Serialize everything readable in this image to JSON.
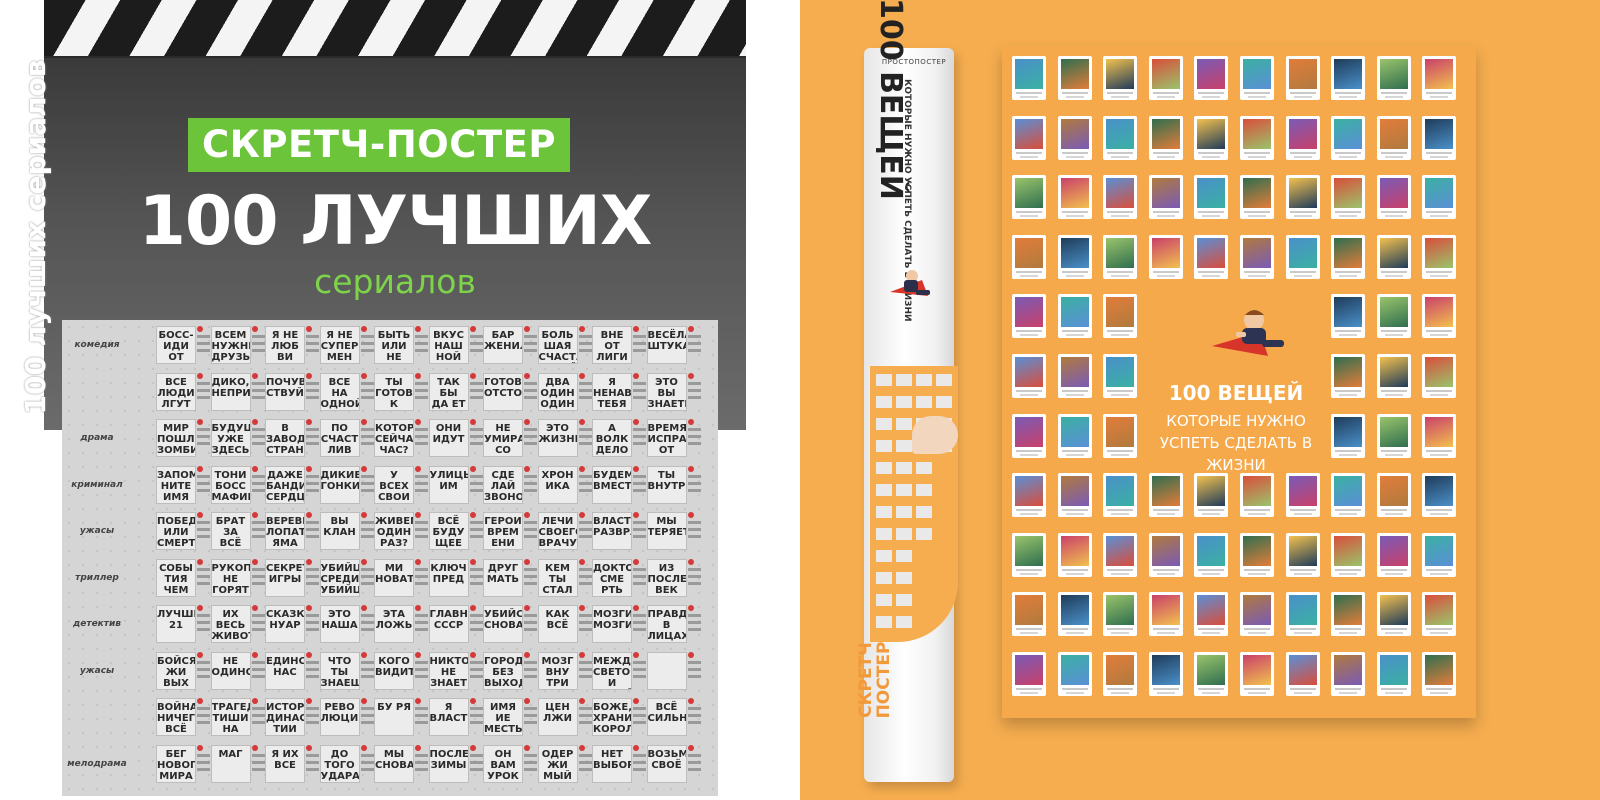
{
  "left_product": {
    "badge": "СКРЕТЧ-ПОСТЕР",
    "title": "100 ЛУЧШИХ",
    "subtitle": "сериалов",
    "poster_vertical_text": "100 лучших сериалов",
    "genres": [
      "комедия",
      "",
      "драма",
      "криминал",
      "ужасы",
      "триллер",
      "детектив",
      "ужасы",
      "",
      "мелодрама"
    ],
    "tiles_row1": [
      "БОСС-ИДИ ОТ",
      "ВСЕМ НУЖНЫ ДРУЗЬЯ",
      "Я НЕ ЛЮБ ВИ",
      "Я НЕ СУПЕР МЕН",
      "БЫТЬ ИЛИ НЕ",
      "ВКУС НАШ НОЙ",
      "БАР ЖЕНИЛ",
      "БОЛЬ ШАЯ СЧАСТЛИВАЯ СЕМЕЙКА",
      "ВНЕ ОТ ЛИГИ",
      "ВЕСЁЛАЯ ШТУКА"
    ],
    "tiles_row2": [
      "ВСЕ ЛЮДИ ЛГУТ",
      "ДИКО, НЕПРИЛИЧНО",
      "ПОЧУВ СТВУЙ",
      "ВСЕ НА ОДНОЙ УЛИЦЕ",
      "ТЫ ГОТОВ К",
      "ТАК БЫ ДА ЕТ",
      "ГОТОВЬ ОТСТОЙ",
      "ДВА ОДИН ОДИН",
      "Я НЕНАВИЖУ ТЕБЯ",
      "ЭТО ВЫ ЗНАЕТЕ"
    ],
    "tiles_row3": [
      "МИР ПОШЛИ ЗОМБИ",
      "БУДУЩЕЕ УЖЕ ЗДЕСЬ",
      "В ЗАВОДЕ СТРАН НОГО",
      "ПО СЧАСТ ЛИВ",
      "КОТОРЫЙ СЕЙЧАС ЧАС?",
      "ОНИ ИДУТ",
      "НЕ УМИРАЙ СО СМЕХУ",
      "ЭТО ЖИЗНЬ",
      "А ВОЛК ДЕЛО ГОВОРИТ",
      "ВРЕМЯ ИСПРАВИТЬ ОТ ЗЛА"
    ],
    "tiles_row4": [
      "ЗАПОМ НИТЕ ИМЯ",
      "ТОНИ БОСС МАФИИ",
      "ДАЖЕ БАНДИТА СЕРДЦЕ",
      "ДИКИЕ ГОНКИ",
      "У ВСЕХ СВОИ СЕКРЕТЫ",
      "УЛИЦЫ ИМ",
      "СДЕ ЛАЙ ЗВОНОК",
      "ХРОН ИКА",
      "БУДЕМ ВМЕСТЕ",
      "ТЫ ВНУТРИ"
    ],
    "tiles_row5": [
      "ПОБЕДА ИЛИ СМЕРТЬ",
      "БРАТ ЗА ВСЁ",
      "ВЕРЕВКА, ЛОПАТА, ЯМА",
      "ВЫ КЛАН",
      "ЖИВЕМ ОДИН РАЗ?",
      "ВСЁ БУДУ ЩЕЕ",
      "ГЕРОИ ВРЕМ ЕНИ",
      "ЛЕЧИ СВОЕГО ВРАЧУ",
      "ВЛАСТЬ РАЗВРАТ",
      "МЫ ТЕРЯЕТЕ"
    ],
    "tiles_row6": [
      "СОБЫ ТИЯ ЧЕМ КАЖУТСЯ",
      "РУКОПИСИ НЕ ГОРЯТ",
      "СЕКРЕТНЫЕ ИГРЫ",
      "УБИЙЦА СРЕДИ УБИЙЦ",
      "МИ НОВАТЬ",
      "КЛЮЧ ПРЕД",
      "ДРУГ МАТЬ",
      "КЕМ ТЫ СТАЛ",
      "ДОКТОР СМЕ РТЬ",
      "ИЗ ПОСЛЕДНИХ ВЕК"
    ],
    "tiles_row7": [
      "ЛУЧШИЙ 21",
      "ИХ ВЕСЬ ЖИВОТНОЕ",
      "СКАЗКИ НУАР",
      "ЭТО НАША",
      "ЭТА ЛОЖЬ",
      "ГЛАВНАЯ СССР",
      "УБИЙСТВО СНОВА",
      "КАК ВСЁ",
      "МОЗГИ МОЗГИ",
      "ПРАВДА В ЛИЦАХ"
    ],
    "tiles_row8": [
      "БОЙСЯ ЖИ ВЫХ",
      "НЕ ОДИНОЧЕСТВО",
      "ЕДИНСТВО НАС",
      "ЧТО ТЫ ЗНАЕШЬ?",
      "КОГО ВИДИТЕ?",
      "НИКТО НЕ ЗНАЕТ",
      "ГОРОД БЕЗ ВЫХОДА",
      "МОЗГ ВНУ ТРИ",
      "МЕЖДУ СВЕТОМ И ТЬМОЙ"
    ],
    "tiles_row9": [
      "ВОЙНА НИЧЕГО ВСЁ",
      "ТРАГЕДИЯ ТИШИ НА",
      "ИСТОРИЯ ДИНАС ТИИ",
      "РЕВО ЛЮЦИИ",
      "БУ РЯ",
      "Я ВЛАСТЬ",
      "ИМЯ ИЕ МЕСТЬ",
      "ЦЕН ЛЖИ",
      "БОЖЕ, ХРАНИ КОРОЛЕВУ",
      "ВСЁ СИЛЬНЕЕ"
    ],
    "tiles_row10": [
      "БЕГ НОВОГО МИРА",
      "МАГ",
      "Я ИХ ВСЕ",
      "ДО ТОГО УДАРА",
      "МЫ СНОВА",
      "ПОСЛЕ ЗИМЫ",
      "ОН ВАМ УРОК",
      "ОДЕР ЖИ МЫЙ",
      "НЕТ ВЫБОРА",
      "ВОЗЬМУ СВОЁ"
    ]
  },
  "right_product": {
    "tube_brand": "ПРОСТОПОСТЕР",
    "tube_title": "100 ВЕЩЕЙ",
    "tube_subtitle": "КОТОРЫЕ НУЖНО УСПЕТЬ СДЕЛАТЬ В ЖИЗНИ",
    "tube_logo_line1": "СКРЕТЧ",
    "tube_logo_line2": "ПОСТЕР",
    "poster_title": "100 ВЕЩЕЙ",
    "poster_subtitle": "КОТОРЫЕ НУЖНО УСПЕТЬ СДЕЛАТЬ В ЖИЗНИ",
    "accent": "#f6ad4f"
  },
  "colors": {
    "badge_green": "#6cc43a",
    "subtitle_green": "#7dd34a",
    "orange_bg": "#f6ad4f",
    "clapper_dark": "#3a3a3a"
  }
}
